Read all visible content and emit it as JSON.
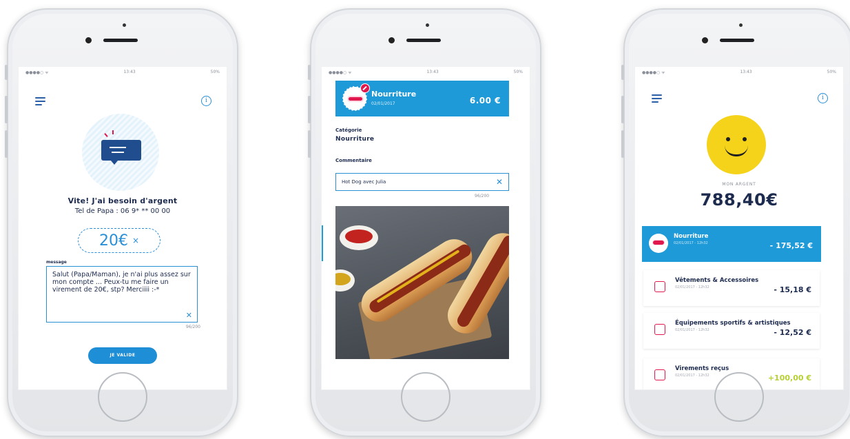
{
  "status_bar": {
    "carrier": "●●●●○ ᯤ",
    "time": "13:43",
    "battery": "50%"
  },
  "phone1": {
    "title": "Vite! J'ai besoin d'argent",
    "subtitle": "Tel de Papa : 06 9* ** 00 00",
    "amount": "20€",
    "clear_symbol": "×",
    "message_label": "message",
    "message_text": "Salut (Papa/Maman), je n'ai plus assez sur mon compte ... Peux-tu me faire un virement de 20€, stp? Merciiii :-*",
    "message_count": "96/200",
    "validate_label": "JE VALIDE"
  },
  "phone2": {
    "category_name": "Nourriture",
    "date": "02/01/2017",
    "amount": "6.00 €",
    "category_label": "Catégorie",
    "category_value": "Nourriture",
    "comment_label": "Commentaire",
    "comment_value": "Hot Dog avec Julia",
    "comment_count": "96/200",
    "clear_symbol": "✕"
  },
  "phone3": {
    "money_label": "MON ARGENT",
    "money_value": "788,40€",
    "transactions": [
      {
        "name": "Nourriture",
        "date": "02/01/2017 - 12h32",
        "amount": "- 175,52 €",
        "icon": "hotdog-icon",
        "active": true
      },
      {
        "name": "Vêtements & Accessoires",
        "date": "02/01/2017 - 12h32",
        "amount": "- 15,18 €",
        "icon": "tshirt-icon",
        "active": false
      },
      {
        "name": "Équipements sportifs & artistiques",
        "date": "02/01/2017 - 12h32",
        "amount": "- 12,52 €",
        "icon": "paint-icon",
        "active": false
      },
      {
        "name": "Virements reçus",
        "date": "02/01/2017 - 12h32",
        "amount": "+100,00 €",
        "icon": "wallet-icon",
        "active": false
      }
    ]
  },
  "colors": {
    "accent": "#1e9ad8",
    "navy": "#1d2b4f",
    "pink": "#e0184e",
    "smiley": "#f5d31a",
    "positive": "#b7d033"
  }
}
